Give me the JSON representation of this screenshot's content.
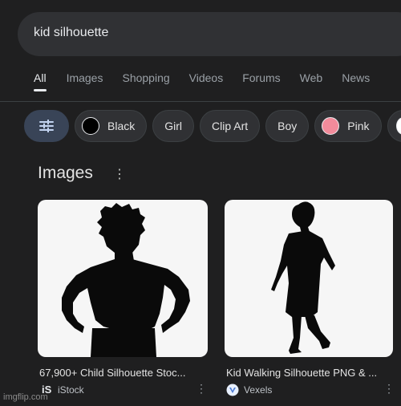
{
  "search": {
    "query": "kid silhouette"
  },
  "tabs": [
    "All",
    "Images",
    "Shopping",
    "Videos",
    "Forums",
    "Web",
    "News"
  ],
  "chips": {
    "black": {
      "label": "Black",
      "color": "#000000"
    },
    "girl": "Girl",
    "clip_art": "Clip Art",
    "boy": "Boy",
    "pink": {
      "label": "Pink",
      "color": "#f28b9b"
    }
  },
  "section": {
    "title": "Images"
  },
  "results": [
    {
      "caption": "67,900+ Child Silhouette Stoc...",
      "source": "iStock",
      "source_icon": "istock-logo-icon"
    },
    {
      "caption": "Kid Walking Silhouette PNG & ...",
      "source": "Vexels",
      "source_icon": "vexels-logo-icon"
    }
  ],
  "watermark": "imgflip.com"
}
